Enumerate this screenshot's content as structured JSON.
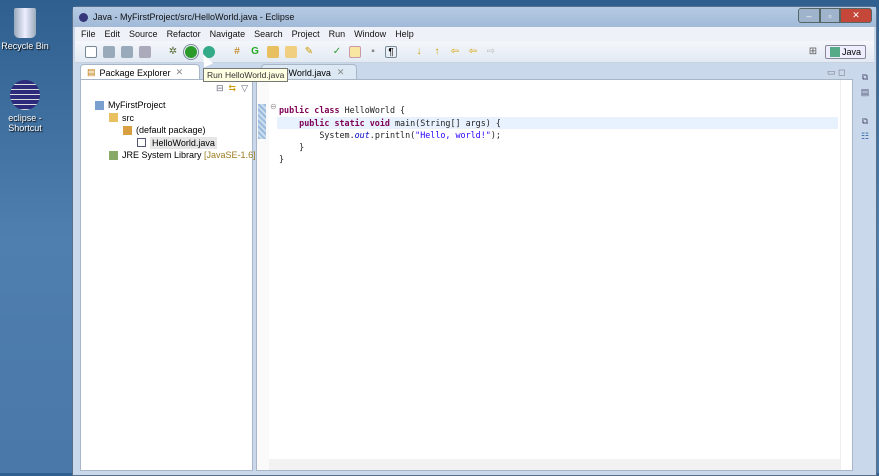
{
  "desktop": {
    "icons": [
      {
        "label": "Recycle Bin",
        "icon": "recycle-bin-icon"
      },
      {
        "label": "eclipse - Shortcut",
        "icon": "eclipse-icon"
      }
    ]
  },
  "window": {
    "title": "Java - MyFirstProject/src/HelloWorld.java - Eclipse",
    "controls": [
      "minimize",
      "maximize",
      "close"
    ]
  },
  "menu": [
    "File",
    "Edit",
    "Source",
    "Refactor",
    "Navigate",
    "Search",
    "Project",
    "Run",
    "Window",
    "Help"
  ],
  "tooltip": "Run HelloWorld.java",
  "perspective": {
    "label": "Java"
  },
  "package_explorer": {
    "tab": "Package Explorer",
    "tree": [
      {
        "label": "MyFirstProject",
        "level": 0,
        "icon": "project-icon"
      },
      {
        "label": "src",
        "level": 1,
        "icon": "source-folder-icon"
      },
      {
        "label": "(default package)",
        "level": 2,
        "icon": "package-icon"
      },
      {
        "label": "HelloWorld.java",
        "level": 3,
        "icon": "java-file-icon"
      },
      {
        "label": "JRE System Library",
        "suffix": "[JavaSE-1.6]",
        "level": 1,
        "icon": "library-icon"
      }
    ]
  },
  "editor": {
    "tab": "HelloWorld.java",
    "code": [
      "public class HelloWorld {",
      "    public static void main(String[] args) {",
      "        System.out.println(\"Hello, world!\");",
      "    }",
      "}"
    ]
  },
  "colors": {
    "keyword": "#7f0055",
    "string": "#2a00ff",
    "current_line": "#e8f2fe"
  }
}
